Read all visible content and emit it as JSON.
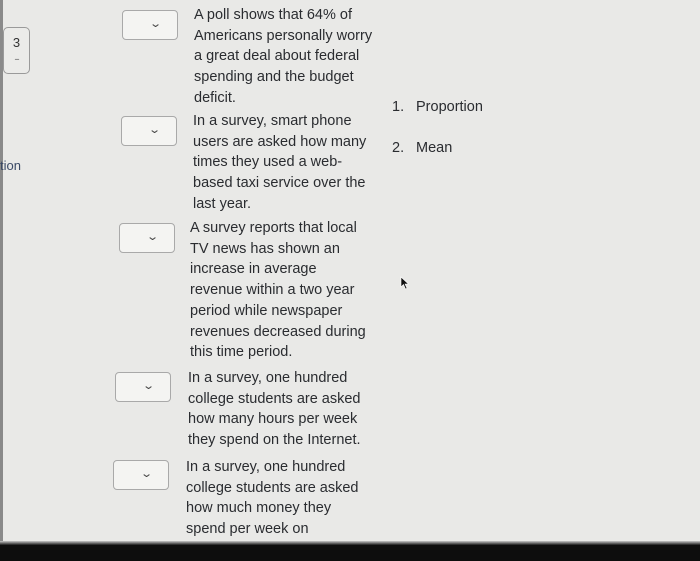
{
  "sidebar": {
    "question_number": "3",
    "question_dash": "--",
    "partial_label": "tion"
  },
  "items": [
    {
      "select_value": "",
      "text": "A poll shows that 64% of Americans personally worry a great deal about federal spending and the budget deficit."
    },
    {
      "select_value": "",
      "text": "In a survey, smart phone users are asked how many times they used a web-based taxi service over the last year."
    },
    {
      "select_value": "",
      "text": "A survey reports that local TV news has shown an increase in average revenue within a two year period while newspaper revenues decreased during this time period."
    },
    {
      "select_value": "",
      "text": "In a survey, one hundred college students are asked how many hours per week they spend on the Internet."
    },
    {
      "select_value": "",
      "text": "In a survey, one hundred college students are asked how much money they spend per week on"
    }
  ],
  "answers": [
    {
      "num": "1.",
      "label": "Proportion"
    },
    {
      "num": "2.",
      "label": "Mean"
    }
  ],
  "icons": {
    "chevron": "⌄"
  }
}
